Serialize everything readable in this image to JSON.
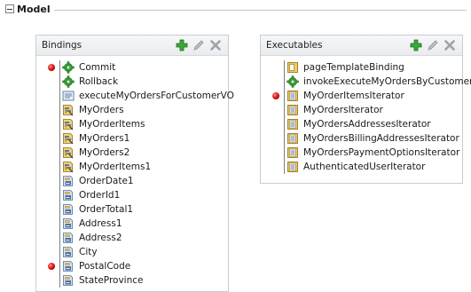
{
  "section": {
    "title": "Model"
  },
  "bindings": {
    "title": "Bindings",
    "items": [
      {
        "label": "Commit",
        "icon": "gear-icon",
        "breakpoint": true
      },
      {
        "label": "Rollback",
        "icon": "gear-icon",
        "breakpoint": false
      },
      {
        "label": "executeMyOrdersForCustomerVO",
        "icon": "method-icon",
        "breakpoint": false
      },
      {
        "label": "MyOrders",
        "icon": "tree-binding-icon",
        "breakpoint": false
      },
      {
        "label": "MyOrderItems",
        "icon": "tree-binding-icon",
        "breakpoint": false
      },
      {
        "label": "MyOrders1",
        "icon": "tree-binding-icon",
        "breakpoint": false
      },
      {
        "label": "MyOrders2",
        "icon": "tree-binding-icon",
        "breakpoint": false
      },
      {
        "label": "MyOrderItems1",
        "icon": "tree-binding-icon",
        "breakpoint": false
      },
      {
        "label": "OrderDate1",
        "icon": "attribute-binding-icon",
        "breakpoint": false
      },
      {
        "label": "OrderId1",
        "icon": "attribute-binding-icon",
        "breakpoint": false
      },
      {
        "label": "OrderTotal1",
        "icon": "attribute-binding-icon",
        "breakpoint": false
      },
      {
        "label": "Address1",
        "icon": "attribute-binding-icon",
        "breakpoint": false
      },
      {
        "label": "Address2",
        "icon": "attribute-binding-icon",
        "breakpoint": false
      },
      {
        "label": "City",
        "icon": "attribute-binding-icon",
        "breakpoint": false
      },
      {
        "label": "PostalCode",
        "icon": "attribute-binding-icon",
        "breakpoint": true
      },
      {
        "label": "StateProvince",
        "icon": "attribute-binding-icon",
        "breakpoint": false
      }
    ]
  },
  "executables": {
    "title": "Executables",
    "items": [
      {
        "label": "pageTemplateBinding",
        "icon": "page-template-icon",
        "breakpoint": false
      },
      {
        "label": "invokeExecuteMyOrdersByCustomer",
        "icon": "gear-icon",
        "breakpoint": false
      },
      {
        "label": "MyOrderItemsIterator",
        "icon": "iterator-icon",
        "breakpoint": true
      },
      {
        "label": "MyOrdersIterator",
        "icon": "iterator-icon",
        "breakpoint": false
      },
      {
        "label": "MyOrdersAddressesIterator",
        "icon": "iterator-icon",
        "breakpoint": false
      },
      {
        "label": "MyOrdersBillingAddressesIterator",
        "icon": "iterator-icon",
        "breakpoint": false
      },
      {
        "label": "MyOrdersPaymentOptionsIterator",
        "icon": "iterator-icon",
        "breakpoint": false
      },
      {
        "label": "AuthenticatedUserIterator",
        "icon": "iterator-icon",
        "breakpoint": false
      }
    ]
  },
  "toolbar_icons": [
    "add-icon",
    "edit-icon",
    "delete-icon"
  ],
  "colors": {
    "breakpoint": "#cc0000",
    "add": "#2e9e2e",
    "gear": "#3aa63a"
  }
}
